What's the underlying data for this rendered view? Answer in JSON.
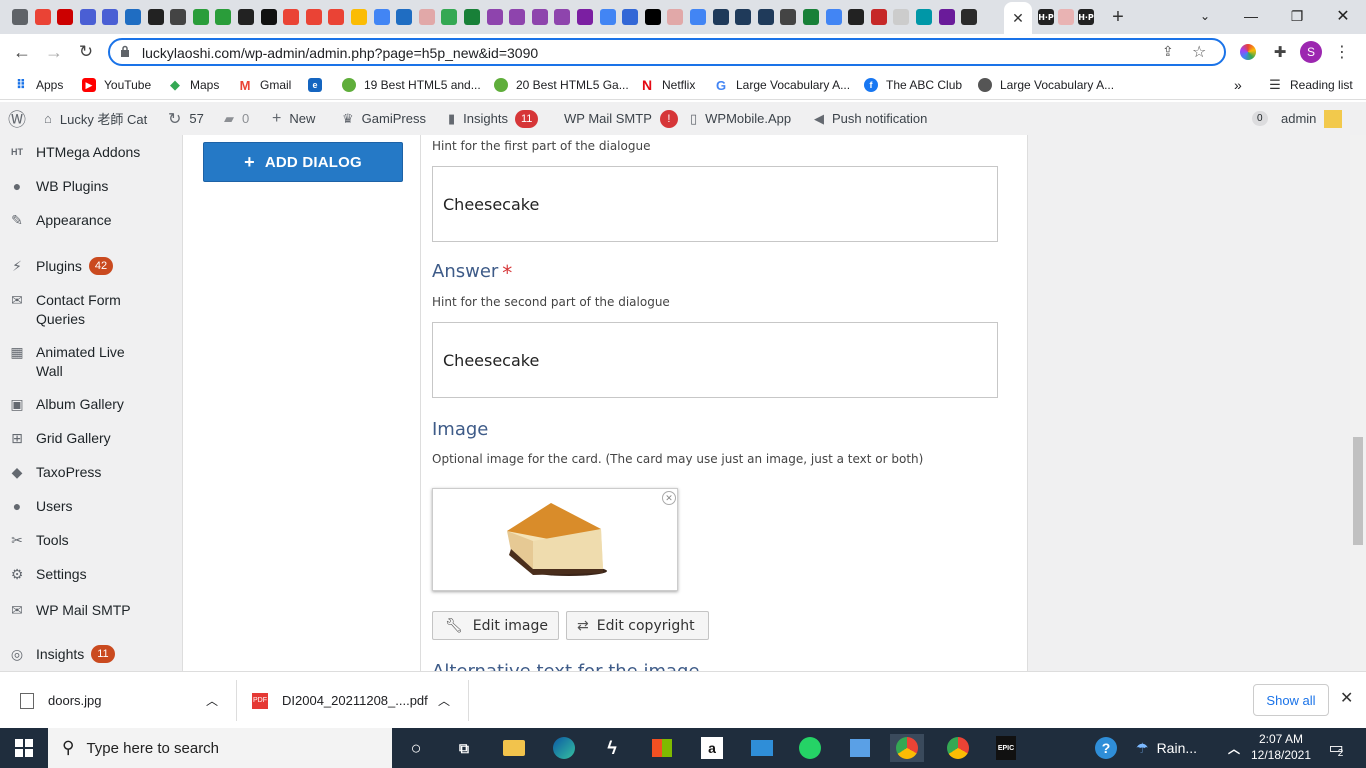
{
  "browser": {
    "url": "luckylaoshi.com/wp-admin/admin.php?page=h5p_new&id=3090",
    "bookmarks": [
      "Apps",
      "YouTube",
      "Maps",
      "Gmail",
      "19 Best HTML5 and...",
      "20 Best HTML5 Ga...",
      "Netflix",
      "Large Vocabulary A...",
      "The ABC Club",
      "Large Vocabulary A..."
    ],
    "reading_list": "Reading list",
    "profile_initial": "S"
  },
  "adminbar": {
    "site": "Lucky 老師 Cat",
    "updates": "57",
    "comments": "0",
    "new": "New",
    "gamipress": "GamiPress",
    "insights": "Insights",
    "insights_count": "11",
    "wpmail": "WP Mail SMTP",
    "wpmail_alert": "!",
    "wpmobile": "WPMobile.App",
    "push": "Push notification",
    "notif_count": "0",
    "user": "admin"
  },
  "sidebar": {
    "items": [
      {
        "label": "HTMega Addons",
        "icon": "ht-icon"
      },
      {
        "label": "WB Plugins",
        "icon": "bulb-icon"
      },
      {
        "label": "Appearance",
        "icon": "brush-icon"
      },
      {
        "label": "Plugins",
        "icon": "plug-icon",
        "badge": "42"
      },
      {
        "label": "Contact Form Queries",
        "icon": "mail-icon"
      },
      {
        "label": "Animated Live Wall",
        "icon": "grid-icon"
      },
      {
        "label": "Album Gallery",
        "icon": "album-icon"
      },
      {
        "label": "Grid Gallery",
        "icon": "grid-gallery-icon"
      },
      {
        "label": "TaxoPress",
        "icon": "tag-icon"
      },
      {
        "label": "Users",
        "icon": "user-icon"
      },
      {
        "label": "Tools",
        "icon": "wrench-icon"
      },
      {
        "label": "Settings",
        "icon": "settings-icon"
      },
      {
        "label": "WP Mail SMTP",
        "icon": "mail-icon"
      },
      {
        "label": "Insights",
        "icon": "insights-icon",
        "badge": "11"
      }
    ]
  },
  "editor": {
    "add_dialog": "ADD DIALOG",
    "text_hint": "Hint for the first part of the dialogue",
    "text_value": "Cheesecake",
    "answer_label": "Answer",
    "answer_required": "*",
    "answer_hint": "Hint for the second part of the dialogue",
    "answer_value": "Cheesecake",
    "image_label": "Image",
    "image_hint": "Optional image for the card. (The card may use just an image, just a text or both)",
    "edit_image": "Edit image",
    "edit_copyright": "Edit copyright",
    "alt_label": "Alternative text for the image"
  },
  "downloads": {
    "items": [
      "doors.jpg",
      "DI2004_20211208_....pdf"
    ],
    "show_all": "Show all"
  },
  "taskbar": {
    "search_placeholder": "Type here to search",
    "weather": "Rain...",
    "time": "2:07 AM",
    "date": "12/18/2021",
    "notifications": "2"
  }
}
